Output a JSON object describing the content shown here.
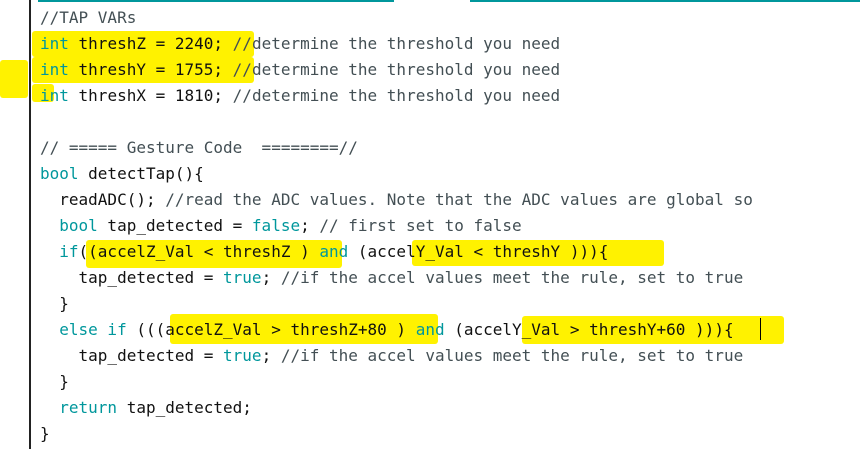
{
  "editor": {
    "colors": {
      "keyword": "#00979c",
      "comment": "#434f54",
      "text": "#111111",
      "highlight": "#fff200",
      "tab_accent": "#00979c"
    },
    "lines": [
      {
        "id": "l1",
        "tokens": [
          {
            "t": "//TAP VARs",
            "c": "cm"
          }
        ]
      },
      {
        "id": "l2",
        "tokens": [
          {
            "t": "int",
            "c": "kw"
          },
          {
            "t": " threshZ = 2240; ",
            "c": "tx"
          },
          {
            "t": "//determine the threshold you need",
            "c": "cm"
          }
        ]
      },
      {
        "id": "l3",
        "tokens": [
          {
            "t": "int",
            "c": "kw"
          },
          {
            "t": " threshY = 1755; ",
            "c": "tx"
          },
          {
            "t": "//determine the threshold you need",
            "c": "cm"
          }
        ]
      },
      {
        "id": "l4",
        "tokens": [
          {
            "t": "int",
            "c": "kw"
          },
          {
            "t": " threshX = 1810; ",
            "c": "tx"
          },
          {
            "t": "//determine the threshold you need",
            "c": "cm"
          }
        ]
      },
      {
        "id": "l5",
        "tokens": [
          {
            "t": "",
            "c": "tx"
          }
        ]
      },
      {
        "id": "l6",
        "tokens": [
          {
            "t": "// ===== Gesture Code  ========//",
            "c": "cm"
          }
        ]
      },
      {
        "id": "l7",
        "tokens": [
          {
            "t": "bool",
            "c": "kw"
          },
          {
            "t": " detectTap(){",
            "c": "tx"
          }
        ]
      },
      {
        "id": "l8",
        "tokens": [
          {
            "t": "  readADC(); ",
            "c": "tx"
          },
          {
            "t": "//read the ADC values. Note that the ADC values are global so",
            "c": "cm"
          }
        ]
      },
      {
        "id": "l9",
        "tokens": [
          {
            "t": "  ",
            "c": "tx"
          },
          {
            "t": "bool",
            "c": "kw"
          },
          {
            "t": " tap_detected = ",
            "c": "tx"
          },
          {
            "t": "false",
            "c": "kw"
          },
          {
            "t": "; ",
            "c": "tx"
          },
          {
            "t": "// first set to false",
            "c": "cm"
          }
        ]
      },
      {
        "id": "l10",
        "tokens": [
          {
            "t": "  ",
            "c": "tx"
          },
          {
            "t": "if",
            "c": "kw"
          },
          {
            "t": "((accelZ_Val < threshZ ) ",
            "c": "tx"
          },
          {
            "t": "and",
            "c": "kw"
          },
          {
            "t": " (accelY_Val < threshY ))){",
            "c": "tx"
          }
        ]
      },
      {
        "id": "l11",
        "tokens": [
          {
            "t": "    tap_detected = ",
            "c": "tx"
          },
          {
            "t": "true",
            "c": "kw"
          },
          {
            "t": "; ",
            "c": "tx"
          },
          {
            "t": "//if the accel values meet the rule, set to true",
            "c": "cm"
          }
        ]
      },
      {
        "id": "l12",
        "tokens": [
          {
            "t": "  }",
            "c": "tx"
          }
        ]
      },
      {
        "id": "l13",
        "tokens": [
          {
            "t": "  ",
            "c": "tx"
          },
          {
            "t": "else if",
            "c": "kw"
          },
          {
            "t": " (((accelZ_Val > threshZ+80 ) ",
            "c": "tx"
          },
          {
            "t": "and",
            "c": "kw"
          },
          {
            "t": " (accelY_Val > threshY+60 ))){",
            "c": "tx"
          }
        ]
      },
      {
        "id": "l14",
        "tokens": [
          {
            "t": "    tap_detected = ",
            "c": "tx"
          },
          {
            "t": "true",
            "c": "kw"
          },
          {
            "t": "; ",
            "c": "tx"
          },
          {
            "t": "//if the accel values meet the rule, set to true",
            "c": "cm"
          }
        ]
      },
      {
        "id": "l15",
        "tokens": [
          {
            "t": "  }",
            "c": "tx"
          }
        ]
      },
      {
        "id": "l16",
        "tokens": [
          {
            "t": "  ",
            "c": "tx"
          },
          {
            "t": "return",
            "c": "kw"
          },
          {
            "t": " tap_detected;",
            "c": "tx"
          }
        ]
      },
      {
        "id": "l17",
        "tokens": [
          {
            "t": "}",
            "c": "tx"
          }
        ]
      }
    ]
  }
}
